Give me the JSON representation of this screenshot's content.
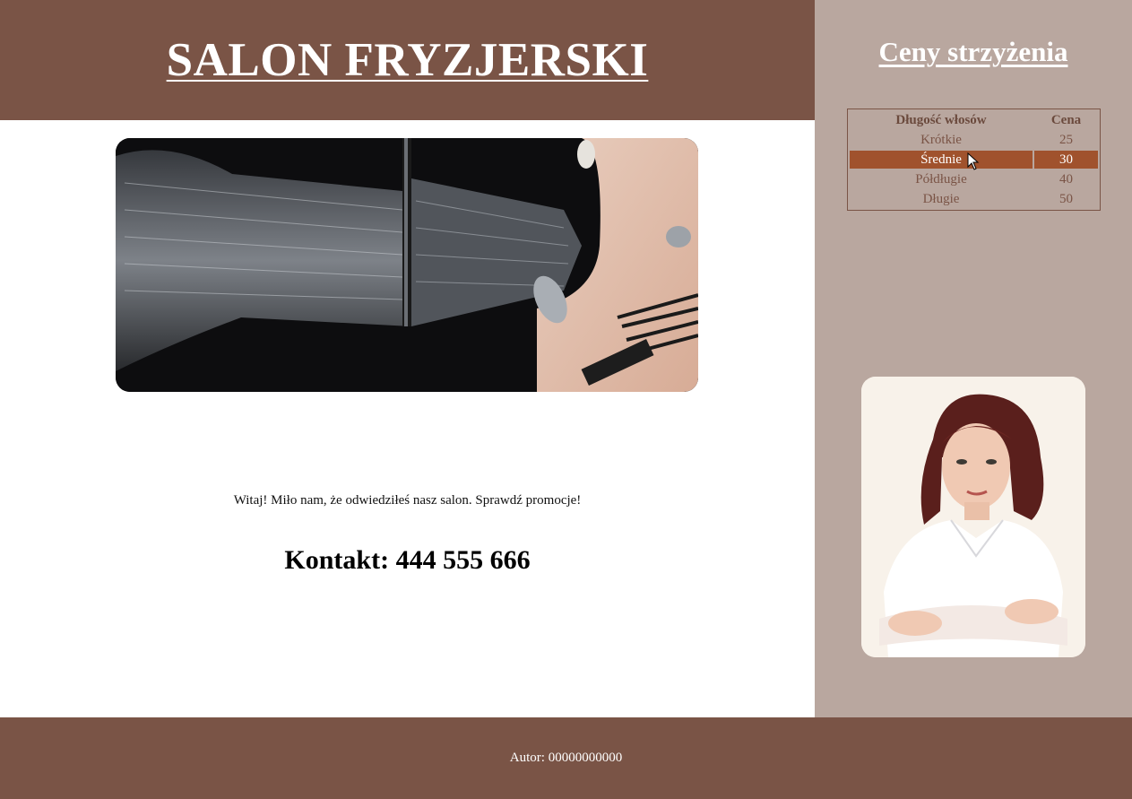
{
  "header": {
    "title": "SALON FRYZJERSKI"
  },
  "main": {
    "welcome": "Witaj! Miło nam, że odwiedziłeś nasz salon. Sprawdź promocje!",
    "contact": "Kontakt: 444 555 666"
  },
  "sidebar": {
    "title": "Ceny strzyżenia",
    "table": {
      "headers": [
        "Długość włosów",
        "Cena"
      ],
      "rows": [
        [
          "Krótkie",
          "25"
        ],
        [
          "Średnie",
          "30"
        ],
        [
          "Półdługie",
          "40"
        ],
        [
          "Długie",
          "50"
        ]
      ],
      "highlighted_row": "Średnie"
    }
  },
  "footer": {
    "author": "Autor: 00000000000"
  },
  "colors": {
    "header_bg": "#7a5446",
    "sidebar_bg": "#b9a79f",
    "row_highlight": "#a0522d",
    "text_white": "#ffffff"
  },
  "icons": [
    "mouse-cursor-icon"
  ]
}
